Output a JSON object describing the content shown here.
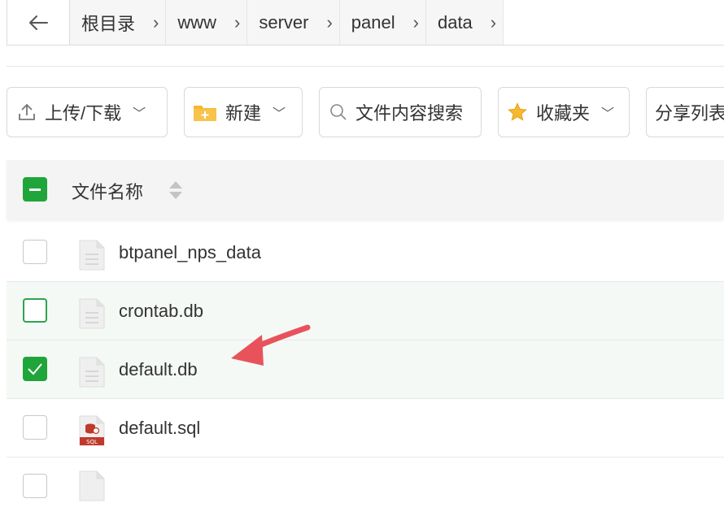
{
  "breadcrumb": {
    "items": [
      "根目录",
      "www",
      "server",
      "panel",
      "data"
    ]
  },
  "toolbar": {
    "upload_label": "上传/下载",
    "new_label": "新建",
    "search_label": "文件内容搜索",
    "favorites_label": "收藏夹",
    "share_label": "分享列表"
  },
  "table": {
    "name_header": "文件名称",
    "rows": [
      {
        "name": "btpanel_nps_data",
        "icon": "file-icon",
        "checked": false
      },
      {
        "name": "crontab.db",
        "icon": "file-icon",
        "checked": false
      },
      {
        "name": "default.db",
        "icon": "file-icon",
        "checked": true
      },
      {
        "name": "default.sql",
        "icon": "sql-file-icon",
        "checked": false
      }
    ]
  },
  "colors": {
    "accent": "#20a53a",
    "arrow": "#e8535b",
    "folder": "#f5b82e"
  }
}
